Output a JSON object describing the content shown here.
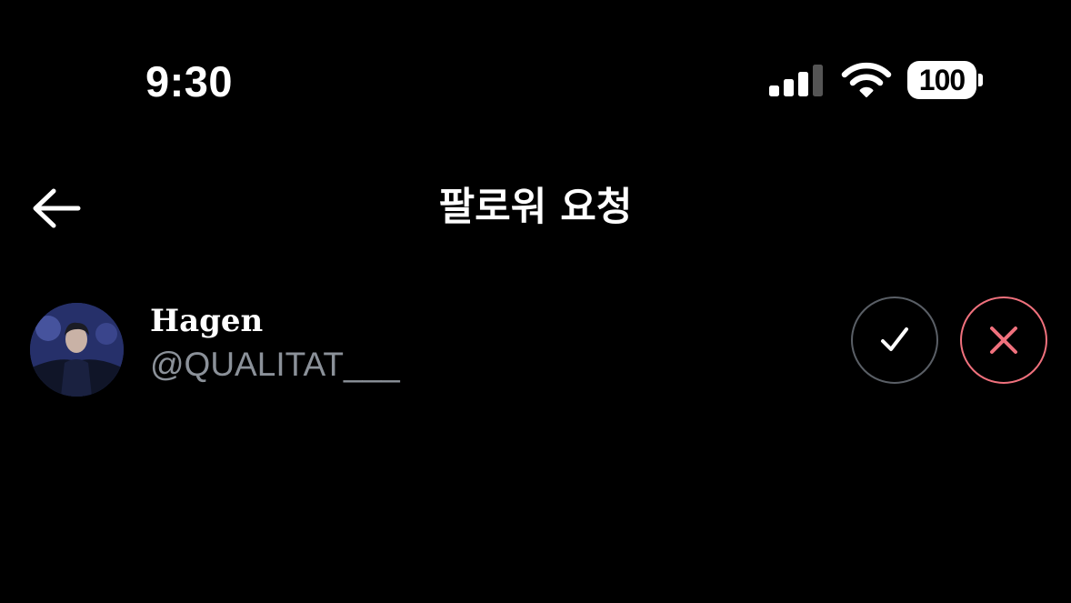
{
  "status_bar": {
    "time": "9:30",
    "battery_level": "100",
    "signal_icon": "cellular-signal-icon",
    "wifi_icon": "wifi-icon"
  },
  "header": {
    "title": "팔로워 요청",
    "back_icon": "arrow-left-icon"
  },
  "requests": [
    {
      "display_name": "Hagen",
      "handle": "@QUALITAT___",
      "accept_icon": "checkmark-icon",
      "decline_icon": "close-icon"
    }
  ],
  "colors": {
    "background": "#000000",
    "text_primary": "#ffffff",
    "text_secondary": "#8b9199",
    "accept_border": "#5a5f66",
    "decline_accent": "#f0717d"
  }
}
